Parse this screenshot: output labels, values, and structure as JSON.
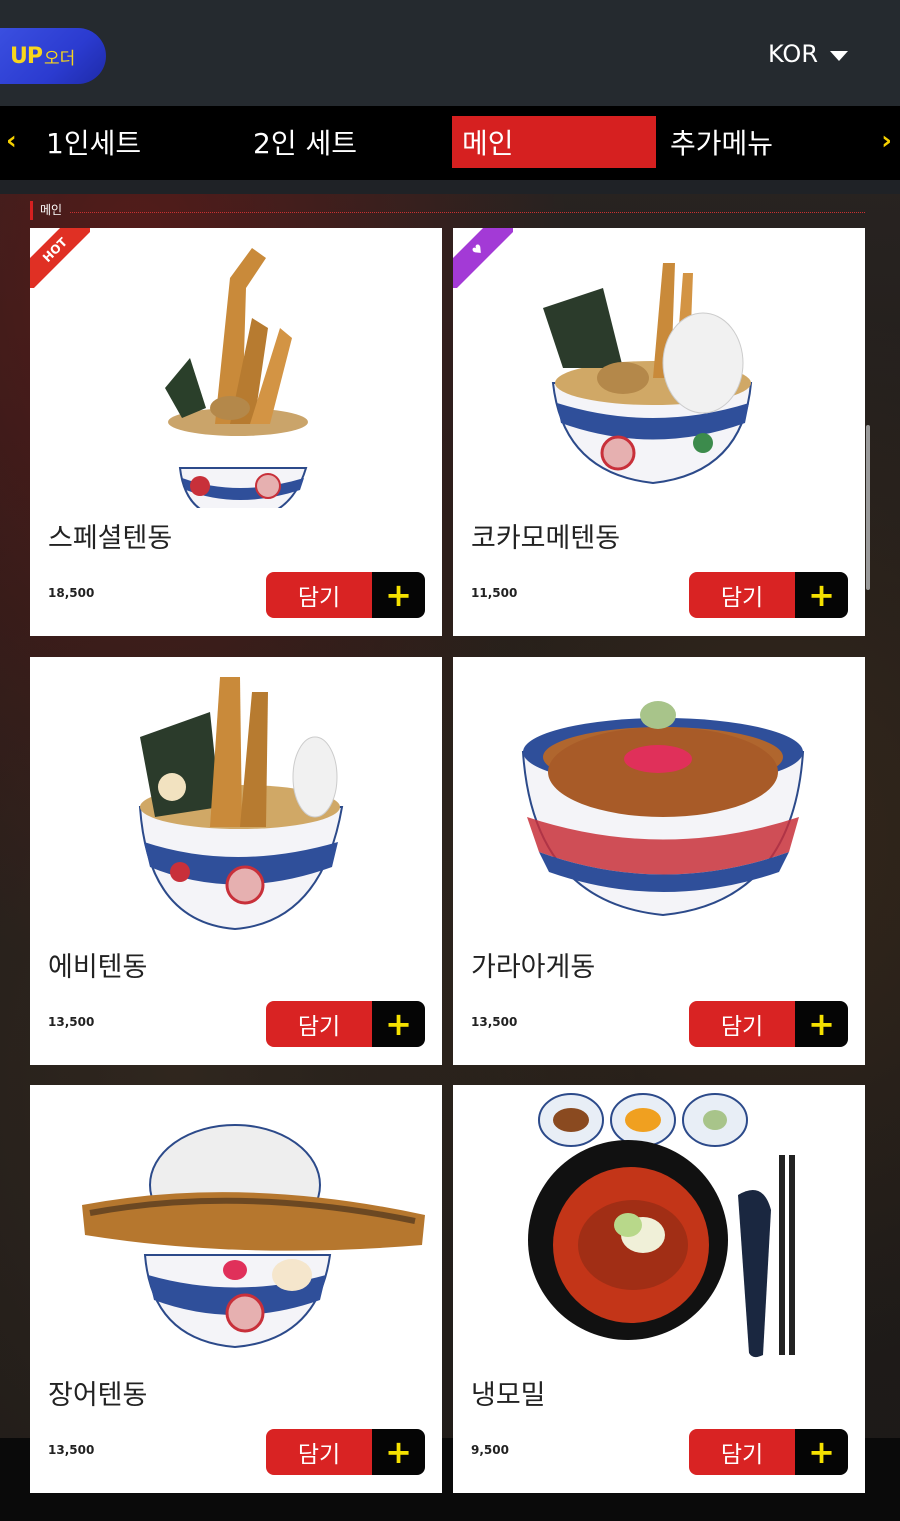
{
  "header": {
    "logo_up": "UP",
    "logo_order": "오더",
    "language": "KOR"
  },
  "tabs": [
    {
      "label": "1인세트",
      "active": false
    },
    {
      "label": "2인 세트",
      "active": false
    },
    {
      "label": "메인",
      "active": true
    },
    {
      "label": "추가메뉴",
      "active": false
    }
  ],
  "section": {
    "title": "메인"
  },
  "menu": [
    {
      "name": "스페셜텐동",
      "price": "18,500",
      "badge": "HOT",
      "button": "담기",
      "plus": "+"
    },
    {
      "name": "코카모메텐동",
      "price": "11,500",
      "badge": "like-icon",
      "button": "담기",
      "plus": "+"
    },
    {
      "name": "에비텐동",
      "price": "13,500",
      "button": "담기",
      "plus": "+"
    },
    {
      "name": "가라아게동",
      "price": "13,500",
      "button": "담기",
      "plus": "+"
    },
    {
      "name": "장어텐동",
      "price": "13,500",
      "button": "담기",
      "plus": "+"
    },
    {
      "name": "냉모밀",
      "price": "9,500",
      "button": "담기",
      "plus": "+"
    }
  ],
  "colors": {
    "accent_red": "#d92323",
    "accent_yellow": "#f5e100",
    "header_bg": "#252a2f",
    "logo_blue": "#2b3bd0"
  }
}
